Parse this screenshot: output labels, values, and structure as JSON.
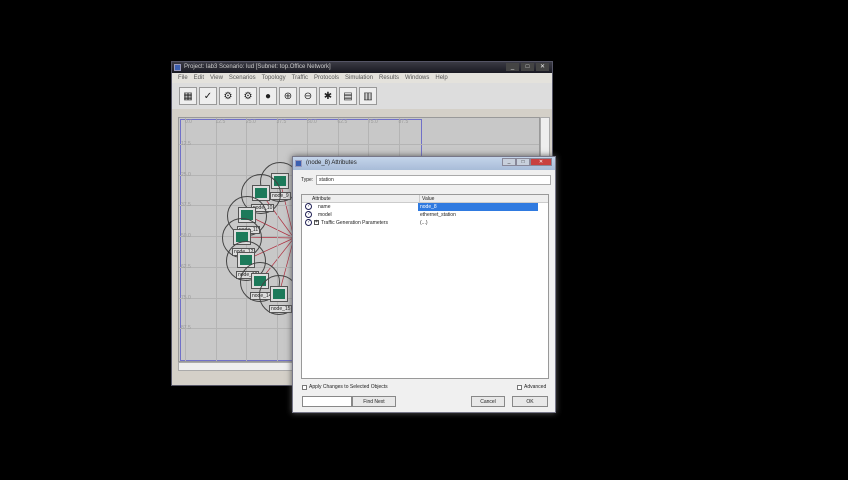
{
  "main_window": {
    "title": "Project: lab3 Scenario: lud [Subnet: top.Office Network]",
    "menu": [
      "File",
      "Edit",
      "View",
      "Scenarios",
      "Topology",
      "Traffic",
      "Protocols",
      "Simulation",
      "Results",
      "Windows",
      "Help"
    ],
    "toolbar_icons": [
      "open-palette-icon",
      "check-links-icon",
      "fail-node-icon",
      "recover-node-icon",
      "return-to-parent-icon",
      "zoom-in-icon",
      "unzoom-icon",
      "configure-discrete-event-icon",
      "view-results-icon",
      "hide-graphs-icon"
    ],
    "x_ticks": [
      "0.0",
      "12.5",
      "25.0",
      "37.5",
      "50.0",
      "62.5",
      "75.0",
      "87.5"
    ],
    "y_ticks": [
      "12.5",
      "25.0",
      "37.5",
      "50.0",
      "62.5",
      "75.0",
      "87.5"
    ],
    "nodes": [
      "node_9",
      "node_10",
      "node_11",
      "node_12",
      "node_13",
      "node_14",
      "node_15"
    ]
  },
  "dialog": {
    "title": "(node_8) Attributes",
    "type_label": "Type:",
    "type_value": "station",
    "columns": [
      "Attribute",
      "Value"
    ],
    "rows": [
      {
        "attr": "name",
        "value": "node_8"
      },
      {
        "attr": "model",
        "value": "ethernet_station"
      },
      {
        "attr": "Traffic Generation Parameters",
        "value": "(...)"
      }
    ],
    "apply_changes": "Apply Changes to Selected Objects",
    "advanced": "Advanced",
    "find_next": "Find Next",
    "find_value": "",
    "cancel": "Cancel",
    "ok": "OK"
  }
}
